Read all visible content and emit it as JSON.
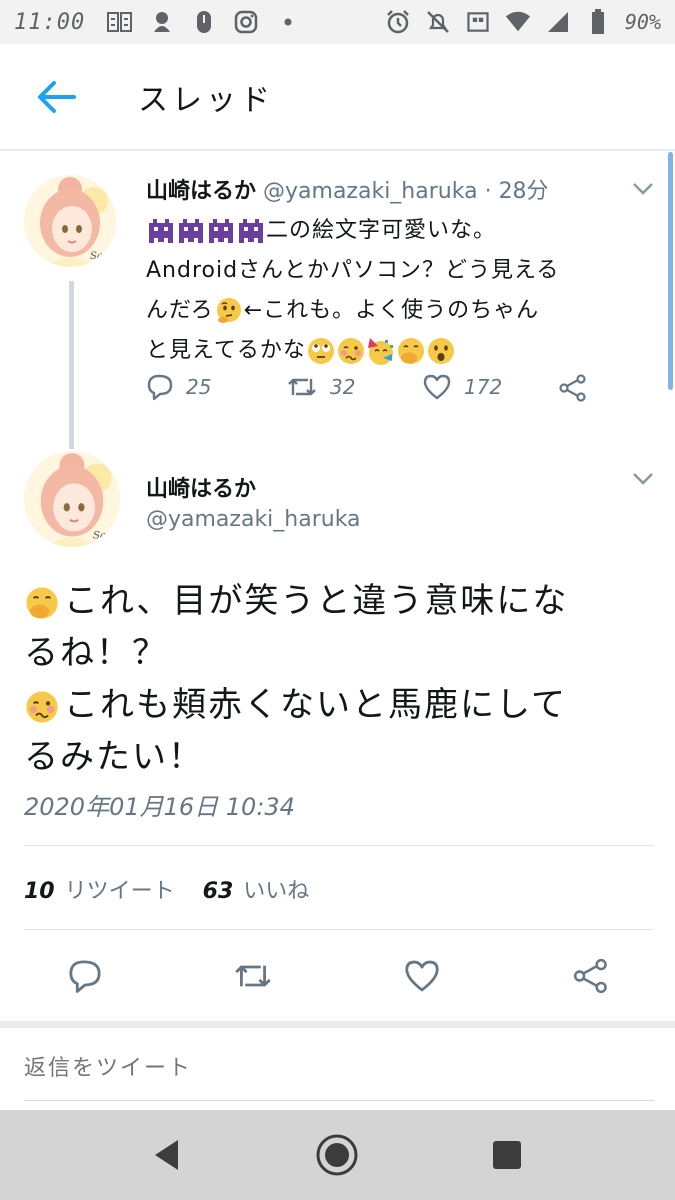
{
  "status_bar": {
    "time": "11:00",
    "battery": "90%"
  },
  "header": {
    "title": "スレッド"
  },
  "tweet1": {
    "name": "山崎はるか",
    "handle": "@yamazaki_haruka",
    "separator": "·",
    "time": "28分",
    "text_line1": "二の絵文字可愛いな。",
    "text_line2": "Androidさんとかパソコン？どう見える",
    "text_line3a": "んだろ",
    "text_line3b": "←これも。よく使うのちゃん",
    "text_line4": "と見えてるかな",
    "replies": "25",
    "retweets": "32",
    "likes": "172"
  },
  "tweet2": {
    "name": "山崎はるか",
    "handle": "@yamazaki_haruka",
    "body_line1": "これ、目が笑うと違う意味にな",
    "body_line2": "るね！？",
    "body_line3": "これも頬赤くないと馬鹿にして",
    "body_line4": "るみたい！",
    "date": "2020年01月16日 10:34",
    "retweet_count": "10",
    "retweet_label": "リツイート",
    "like_count": "63",
    "like_label": "いいね"
  },
  "reply": {
    "placeholder": "返信をツイート"
  },
  "colors": {
    "accent": "#1da1f2",
    "secondary_text": "#657786",
    "alien_purple": "#6b3fa0"
  }
}
